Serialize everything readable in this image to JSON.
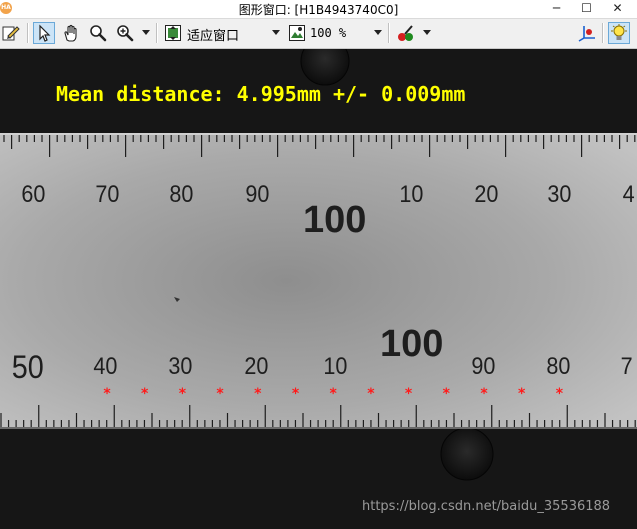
{
  "window": {
    "logo": "HA",
    "title": "图形窗口: [H1B4943740C0]",
    "min_glyph": "─",
    "max_glyph": "☐",
    "close_glyph": "✕"
  },
  "toolbar": {
    "zoom_mode": "适应窗口",
    "zoom_percent": "100 %"
  },
  "overlay": {
    "measurement": "Mean distance: 4.995mm +/- 0.009mm",
    "watermark": "https://blog.csdn.net/baidu_35536188",
    "text_color": "#ffff00",
    "marker_color": "#ff1a1a"
  },
  "ruler": {
    "upper_big_label": "100",
    "upper_labels": [
      "60",
      "70",
      "80",
      "90",
      "10",
      "20",
      "30",
      "4"
    ],
    "lower_big_label": "100",
    "lower_labels": [
      "50",
      "40",
      "30",
      "20",
      "10",
      "90",
      "80",
      "7"
    ],
    "marker_count": 13
  }
}
